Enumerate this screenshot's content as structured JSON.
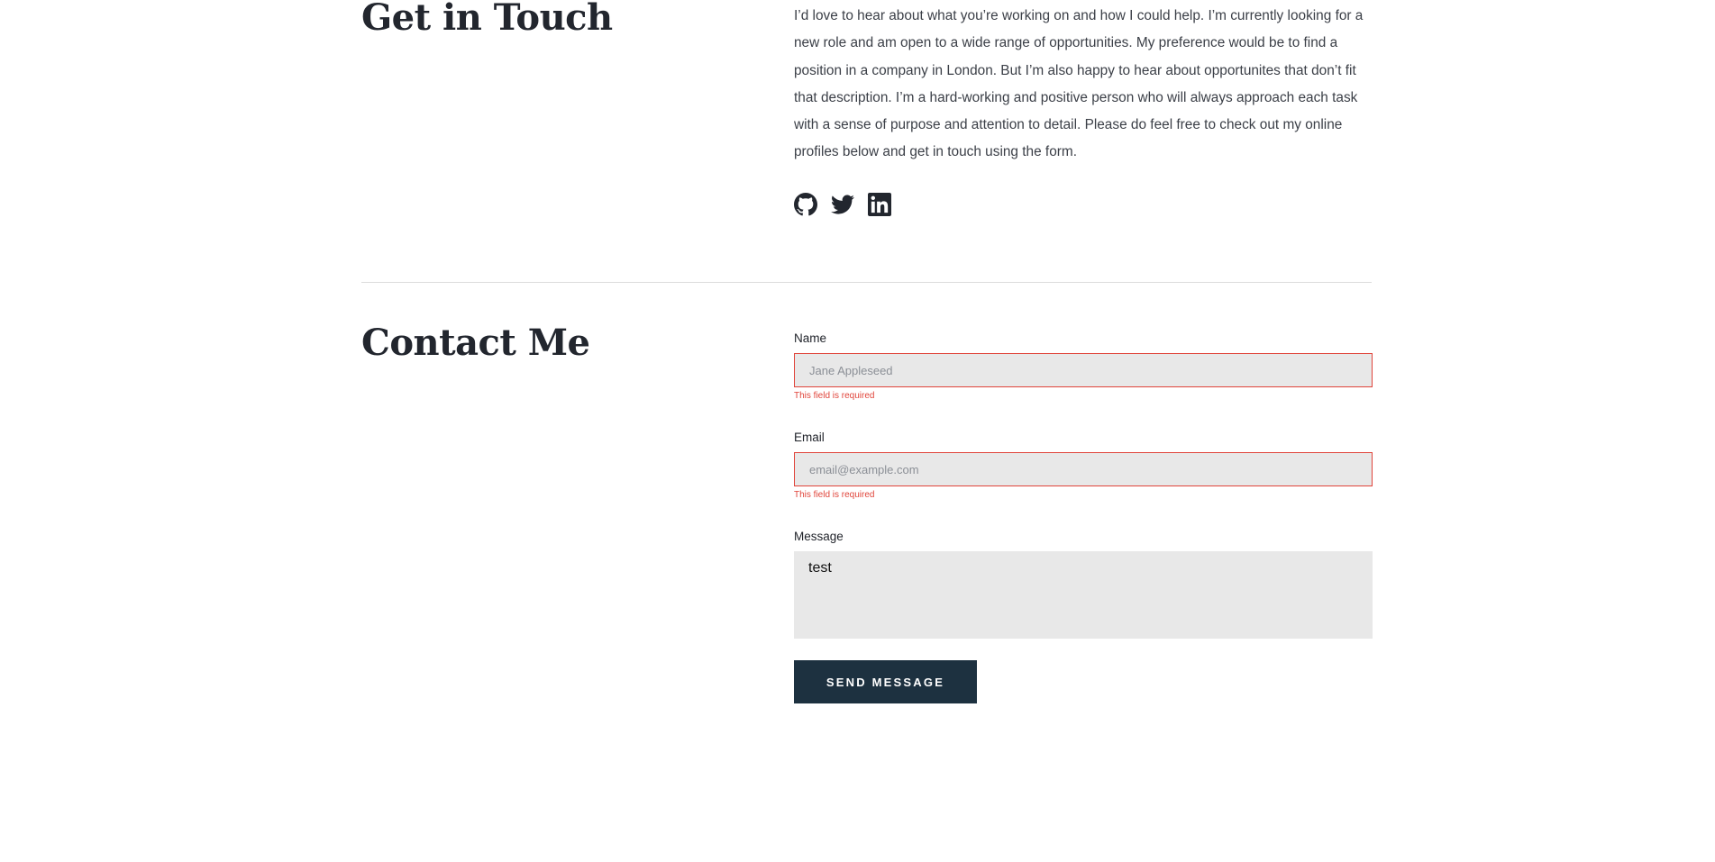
{
  "touch": {
    "title": "Get in Touch",
    "body": "I’d love to hear about what you’re working on and how I could help. I’m currently looking for a new role and am open to a wide range of opportunities. My preference would be to find a position in a company in London. But I’m also happy to hear about opportunites that don’t fit that description. I’m a hard-working and positive person who will always approach each task with a sense of purpose and attention to detail. Please do feel free to check out my online profiles below and get in touch using the form.",
    "social": [
      {
        "icon": "github-icon"
      },
      {
        "icon": "twitter-icon"
      },
      {
        "icon": "linkedin-icon"
      }
    ]
  },
  "contact": {
    "title": "Contact Me",
    "name": {
      "label": "Name",
      "placeholder": "Jane Appleseed",
      "value": "",
      "error": "This field is required"
    },
    "email": {
      "label": "Email",
      "placeholder": "email@example.com",
      "value": "",
      "error": "This field is required"
    },
    "message": {
      "label": "Message",
      "value": "test"
    },
    "submit_label": "SEND MESSAGE"
  },
  "colors": {
    "text": "#22262e",
    "error": "#e0443a",
    "button": "#1d3140",
    "field_bg": "#e8e8e8",
    "divider": "#dcdcdc"
  }
}
